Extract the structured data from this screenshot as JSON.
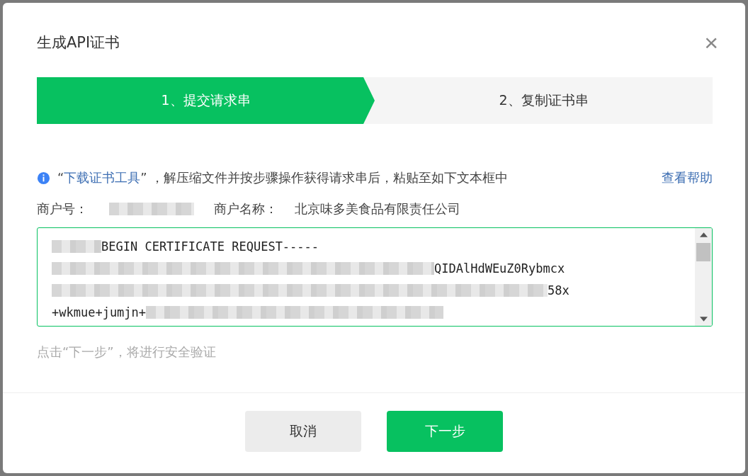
{
  "dialog": {
    "title": "生成API证书",
    "close": "×"
  },
  "steps": [
    {
      "label": "1、提交请求串",
      "selected": true
    },
    {
      "label": "2、复制证书串",
      "selected": false
    }
  ],
  "notice": {
    "prefix": "“",
    "link": "下载证书工具",
    "suffix": "” ，解压缩文件并按步骤操作获得请求串后，粘贴至如下文本框中",
    "help": "查看帮助"
  },
  "merchant": {
    "id_label": "商户号：",
    "name_label": "商户名称：",
    "name": "北京味多美食品有限责任公司"
  },
  "request_field": {
    "lines": [
      "BEGIN CERTIFICATE REQUEST-----",
      "QIDAlHdWEuZ0Rybmcx",
      "58x",
      "+wkmue+jumjn+"
    ]
  },
  "hint": "点击“下一步”，将进行安全验证",
  "buttons": [
    {
      "label": "取消",
      "kind": "secondary"
    },
    {
      "label": "下一步",
      "kind": "primary"
    }
  ]
}
